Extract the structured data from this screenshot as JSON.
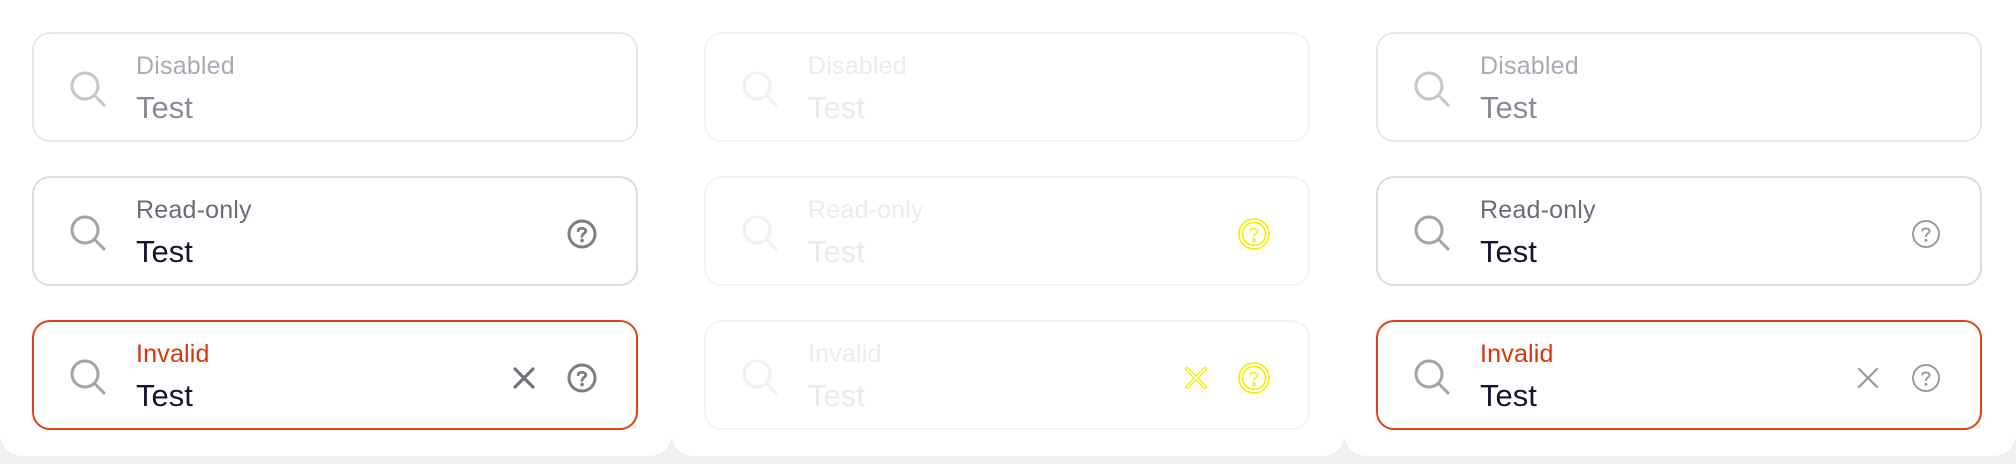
{
  "panels": [
    {
      "fields": [
        {
          "label": "Disabled",
          "value": "Test"
        },
        {
          "label": "Read-only",
          "value": "Test"
        },
        {
          "label": "Invalid",
          "value": "Test"
        }
      ]
    },
    {
      "fields": [
        {
          "label": "Disabled",
          "value": "Test"
        },
        {
          "label": "Read-only",
          "value": "Test"
        },
        {
          "label": "Invalid",
          "value": "Test"
        }
      ]
    },
    {
      "fields": [
        {
          "label": "Disabled",
          "value": "Test"
        },
        {
          "label": "Read-only",
          "value": "Test"
        },
        {
          "label": "Invalid",
          "value": "Test"
        }
      ]
    }
  ],
  "icons": {
    "search": "search-icon",
    "help": "help-circle-icon",
    "clear": "close-icon"
  },
  "colors": {
    "invalid": "#e0401a",
    "highlight": "#f5f000",
    "text": "#141433"
  }
}
